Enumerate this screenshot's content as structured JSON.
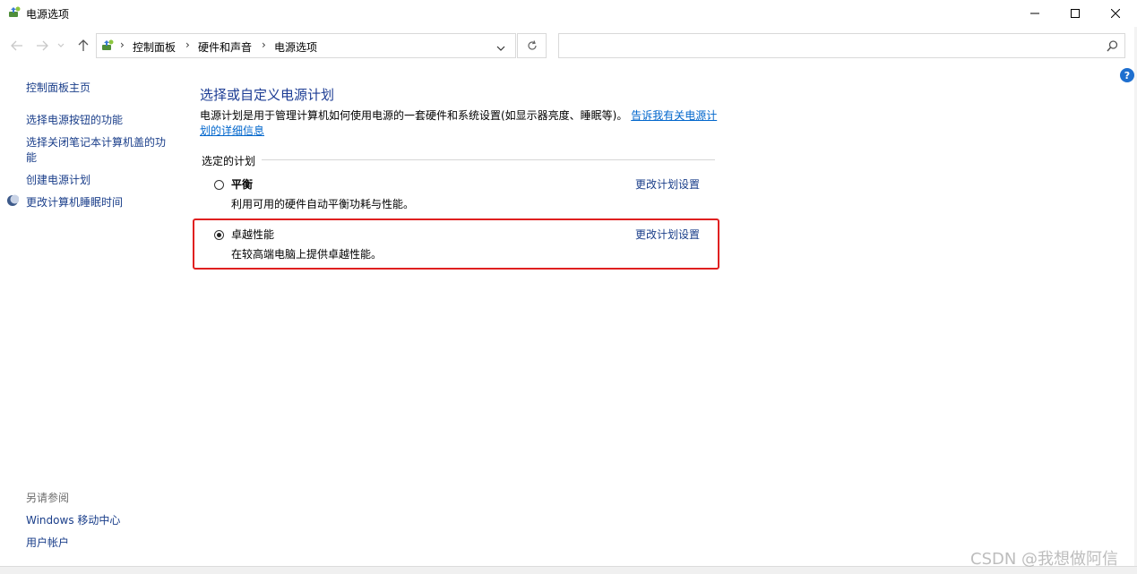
{
  "window": {
    "title": "电源选项",
    "minimize_icon": "minimize-icon",
    "maximize_icon": "maximize-icon",
    "close_icon": "close-icon"
  },
  "navbar": {
    "back_icon": "arrow-left-icon",
    "forward_icon": "arrow-right-icon",
    "recent_icon": "chevron-down-icon",
    "up_icon": "arrow-up-icon",
    "breadcrumb": [
      "控制面板",
      "硬件和声音",
      "电源选项"
    ],
    "refresh_icon": "refresh-icon",
    "search_value": "",
    "search_icon": "search-icon"
  },
  "sidebar": {
    "home_link": "控制面板主页",
    "links": [
      "选择电源按钮的功能",
      "选择关闭笔记本计算机盖的功",
      "能",
      "创建电源计划",
      "更改计算机睡眠时间"
    ],
    "see_also_title": "另请参阅",
    "see_also_links": [
      "Windows 移动中心",
      "用户帐户"
    ]
  },
  "main": {
    "title": "选择或自定义电源计划",
    "description": "电源计划是用于管理计算机如何使用电源的一套硬件和系统设置(如显示器亮度、睡眠等)。",
    "description_link_1": "告诉我有关电源计",
    "description_link_2": "划的详细信息",
    "group_label": "选定的计划",
    "plans": [
      {
        "name": "平衡",
        "description": "利用可用的硬件自动平衡功耗与性能。",
        "change_link": "更改计划设置",
        "selected": false
      },
      {
        "name": "卓越性能",
        "description": "在较高端电脑上提供卓越性能。",
        "change_link": "更改计划设置",
        "selected": true
      }
    ]
  },
  "help_label": "?",
  "watermark": "CSDN @我想做阿信",
  "colors": {
    "link": "#1a3e8a",
    "title": "#1c3c94",
    "highlight": "#e02020"
  }
}
